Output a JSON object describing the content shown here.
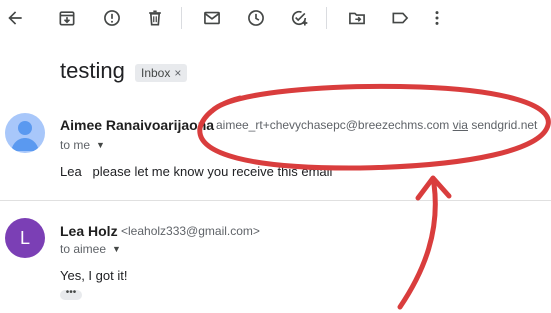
{
  "toolbar": {
    "icons": [
      "back-arrow-icon",
      "archive-icon",
      "report-spam-icon",
      "delete-icon",
      "mark-unread-icon",
      "snooze-icon",
      "add-task-icon",
      "move-to-icon",
      "label-icon",
      "more-options-icon"
    ]
  },
  "subject": "testing",
  "label_chip": {
    "text": "Inbox",
    "remove": "×"
  },
  "messages": [
    {
      "avatar": "",
      "sender": "Aimee Ranaivoarijaona",
      "address": "aimee_rt+chevychasepc@breezechms.com",
      "via": "via",
      "via_domain": "sendgrid.net",
      "to": "to me",
      "body": "Lea   please let me know you receive this email"
    },
    {
      "avatar": "L",
      "sender": "Lea Holz",
      "address": "<leaholz333@gmail.com>",
      "to": "to aimee",
      "body": "Yes, I got it!",
      "more": "•••"
    }
  ],
  "colors": {
    "annotation_red": "#d93d3d",
    "avatar_purple": "#7b3fb5",
    "avatar_blue": "#a8c7fa"
  }
}
